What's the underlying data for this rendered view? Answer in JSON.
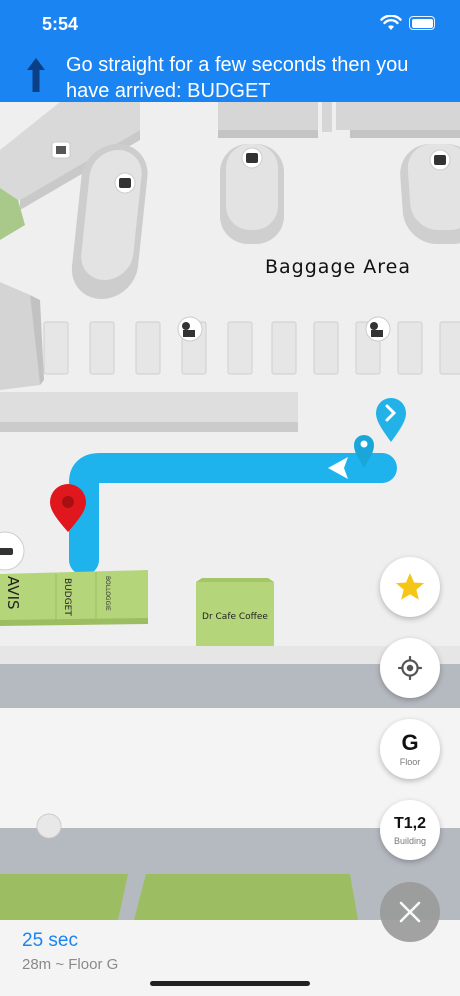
{
  "status": {
    "time": "5:54"
  },
  "navigation": {
    "instruction": "Go straight for a few seconds then you have arrived: BUDGET"
  },
  "map": {
    "area_label": "Baggage Area",
    "stores": [
      "AVIS",
      "BUDGET",
      "Dr Cafe Coffee"
    ],
    "small_label": "BOLLOGGIE"
  },
  "controls": {
    "favorite": {
      "icon": "star-icon"
    },
    "locate": {
      "icon": "crosshair-icon"
    },
    "floor": {
      "value": "G",
      "label": "Floor"
    },
    "building": {
      "value": "T1,2",
      "label": "Building"
    },
    "close": {
      "icon": "close-icon"
    }
  },
  "route": {
    "eta": "25 sec",
    "distance": "28m ~ Floor G"
  },
  "colors": {
    "accent": "#1a84f2",
    "route": "#1fb3ee",
    "pin": "#e0181d",
    "store": "#b5d57a",
    "star": "#f5c518"
  }
}
